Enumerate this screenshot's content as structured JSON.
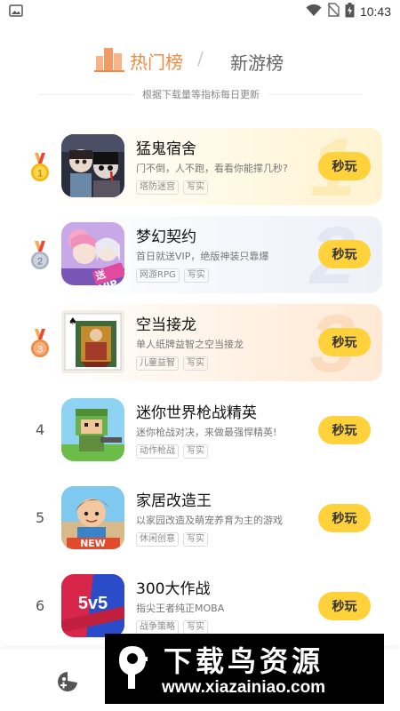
{
  "status_bar": {
    "time": "10:43",
    "icons": [
      "image-icon",
      "wifi-icon",
      "no-sim-icon",
      "battery-charging-icon"
    ]
  },
  "tabs": {
    "hot": "热门榜",
    "separator": "/",
    "new": "新游榜",
    "active": "hot"
  },
  "subtitle": "根据下载量等指标每日更新",
  "games": [
    {
      "rank": "1",
      "title": "猛鬼宿舍",
      "desc": "门不倒，人不跑，看看你能撑几秒?",
      "tags": [
        "塔防迷宫",
        "写实"
      ],
      "button": "秒玩"
    },
    {
      "rank": "2",
      "title": "梦幻契约",
      "desc": "首日就送VIP，绝版神装只靠爆",
      "tags": [
        "网游RPG",
        "写实"
      ],
      "button": "秒玩",
      "icon_badge": "送VIP"
    },
    {
      "rank": "3",
      "title": "空当接龙",
      "desc": "单人纸牌益智之空当接龙",
      "tags": [
        "儿童益智",
        "写实"
      ],
      "button": "秒玩"
    },
    {
      "rank": "4",
      "title": "迷你世界枪战精英",
      "desc": "迷你枪战对决，来做最强悍精英!",
      "tags": [
        "动作枪战",
        "写实"
      ],
      "button": "秒玩"
    },
    {
      "rank": "5",
      "title": "家居改造王",
      "desc": "以家园改造及萌宠养育为主的游戏",
      "tags": [
        "休闲创意",
        "写实"
      ],
      "button": "秒玩",
      "icon_badge": "NEW"
    },
    {
      "rank": "6",
      "title": "300大作战",
      "desc": "指尖王者纯正MOBA",
      "tags": [
        "战争策略",
        "写实"
      ],
      "button": "秒玩",
      "icon_badge": "5v5"
    }
  ],
  "bottom_nav": {
    "icons": [
      "game-controller-icon"
    ]
  },
  "watermark": {
    "title": "下载鸟资源",
    "url": "www.xiazainiao.com"
  },
  "colors": {
    "accent": "#ef8a45",
    "button": "#ffd23c",
    "rank1": "#f5b800",
    "rank2": "#a9b1c2",
    "rank3": "#ef8a45"
  }
}
